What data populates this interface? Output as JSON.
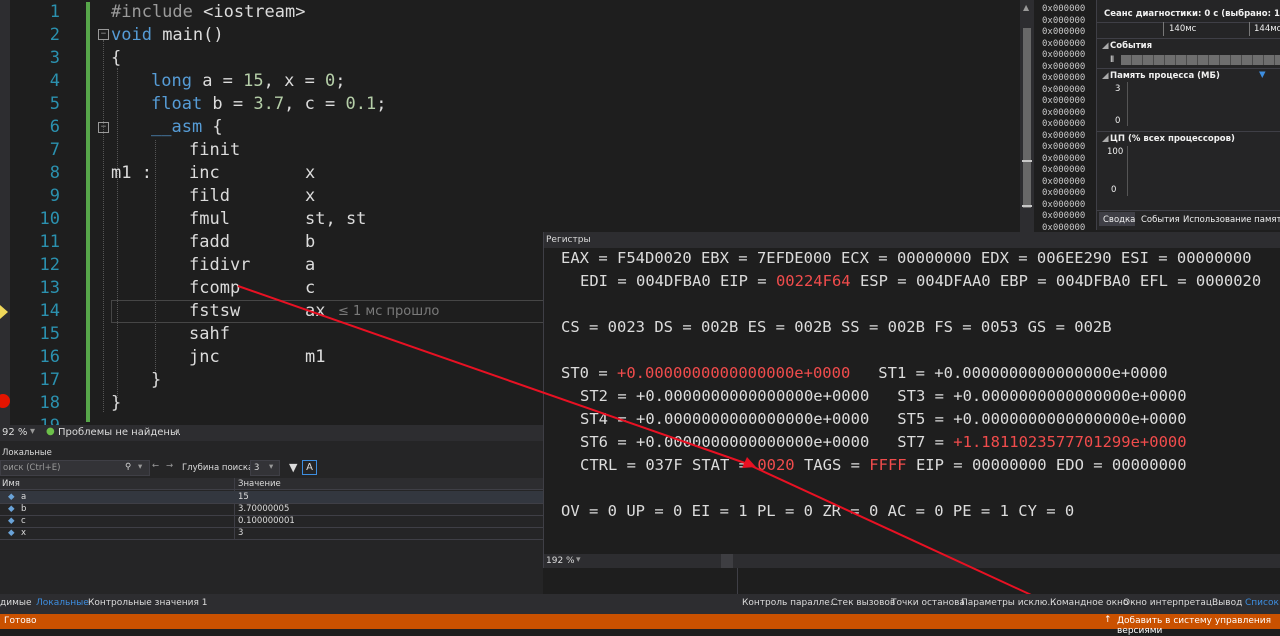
{
  "editor": {
    "line_numbers": [
      "1",
      "2",
      "3",
      "4",
      "5",
      "6",
      "7",
      "8",
      "9",
      "10",
      "11",
      "12",
      "13",
      "14",
      "15",
      "16",
      "17",
      "18",
      "19"
    ],
    "lines": {
      "l1": {
        "pp": "#include",
        "rest": " <iostream>"
      },
      "l2": {
        "kw": "void",
        "rest": " main()"
      },
      "l3": "{",
      "l4": {
        "kw": "long",
        "pre": " a = ",
        "n1": "15",
        "mid": ", x = ",
        "n2": "0",
        "end": ";"
      },
      "l5": {
        "kw": "float",
        "pre": " b = ",
        "n1": "3.7",
        "mid": ", c = ",
        "n2": "0.1",
        "end": ";"
      },
      "l6": {
        "kw": "__asm",
        "rest": " {"
      },
      "l7": "finit",
      "l8_label": "m1 :",
      "asm": [
        {
          "op": "inc",
          "arg": "x"
        },
        {
          "op": "fild",
          "arg": "x"
        },
        {
          "op": "fmul",
          "arg": "st, st"
        },
        {
          "op": "fadd",
          "arg": "b"
        },
        {
          "op": "fidivr",
          "arg": "a"
        },
        {
          "op": "fcomp",
          "arg": "c"
        },
        {
          "op": "fstsw",
          "arg": "ax"
        },
        {
          "op": "sahf",
          "arg": ""
        },
        {
          "op": "jnc",
          "arg": "m1"
        }
      ],
      "l17": "}",
      "l18": "}"
    },
    "elapsed_hint": "≤ 1 мс прошло",
    "zoom": "92 %",
    "issues": "Проблемы не найдены."
  },
  "memory": {
    "addresses": [
      "0x000000",
      "0x000000",
      "0x000000",
      "0x000000",
      "0x000000",
      "0x000000",
      "0x000000",
      "0x000000",
      "0x000000",
      "0x000000",
      "0x000000",
      "0x000000",
      "0x000000",
      "0x000000",
      "0x000000",
      "0x000000",
      "0x000000",
      "0x000000",
      "0x000000",
      "0x000000"
    ]
  },
  "diagnostics": {
    "session": "Сеанс диагностики: 0 с (выбрано: 150 мс)",
    "tick1": "140мс",
    "tick2": "144мс",
    "events_label": "События",
    "memory_label": "Память процесса (МБ)",
    "mem_axis_top": "3",
    "mem_axis_bottom": "0",
    "cpu_label": "ЦП (% всех процессоров)",
    "cpu_axis_top": "100",
    "cpu_axis_bottom": "0",
    "tabs": [
      "Сводка",
      "События",
      "Использование памяти"
    ]
  },
  "locals": {
    "title": "Локальные",
    "search_placeholder": "оиск (Ctrl+E)",
    "depth_label": "Глубина поиска:",
    "depth_value": "3",
    "col_name": "Имя",
    "col_value": "Значение",
    "rows": [
      {
        "name": "a",
        "value": "15"
      },
      {
        "name": "b",
        "value": "3.70000005"
      },
      {
        "name": "c",
        "value": "0.100000001"
      },
      {
        "name": "x",
        "value": "3"
      }
    ]
  },
  "registers": {
    "title": "Регистры",
    "line1": "EAX = F54D0020 EBX = 7EFDE000 ECX = 00000000 EDX = 006EE290 ESI = 00000000",
    "line2_a": "EDI = 004DFBA0 EIP = ",
    "line2_eip": "00224F64",
    "line2_b": " ESP = 004DFAA0 EBP = 004DFBA0 EFL = 0000020",
    "line3": "CS = 0023 DS = 002B ES = 002B SS = 002B FS = 0053 GS = 002B",
    "st0_a": "ST0 = ",
    "st0_v": "+0.0000000000000000e+0000",
    "st0_b": "   ST1 = +0.0000000000000000e+0000",
    "st23": "ST2 = +0.0000000000000000e+0000   ST3 = +0.0000000000000000e+0000",
    "st45": "ST4 = +0.0000000000000000e+0000   ST5 = +0.0000000000000000e+0000",
    "st67_a": "ST6 = +0.0000000000000000e+0000   ST7 = ",
    "st7_v": "+1.1811023577701299e+0000",
    "ctrl_a": "CTRL = 037F STAT = ",
    "stat_v": "0020",
    "ctrl_b": " TAGS = ",
    "tags_v": "FFFF",
    "ctrl_c": " EIP = 00000000 EDO = 00000000",
    "flags": "OV = 0 UP = 0 EI = 1 PL = 0 ZR = 0 AC = 0 PE = 1 CY = 0",
    "zoom": "192 %"
  },
  "bottom_tabs_left": [
    "димые",
    "Локальные",
    "Контрольные значения 1"
  ],
  "bottom_tabs_right": [
    "Контроль паралле...",
    "Стек вызовов",
    "Точки останова",
    "Параметры исклю...",
    "Командное окно",
    "Окно интерпретац...",
    "Вывод",
    "Список ош"
  ],
  "status": {
    "ready": "Готово",
    "vcs": "Добавить в систему управления версиями"
  },
  "colors": {
    "accent": "#ca5100",
    "highlight": "#f14c4c",
    "arrow": "#e81123"
  }
}
